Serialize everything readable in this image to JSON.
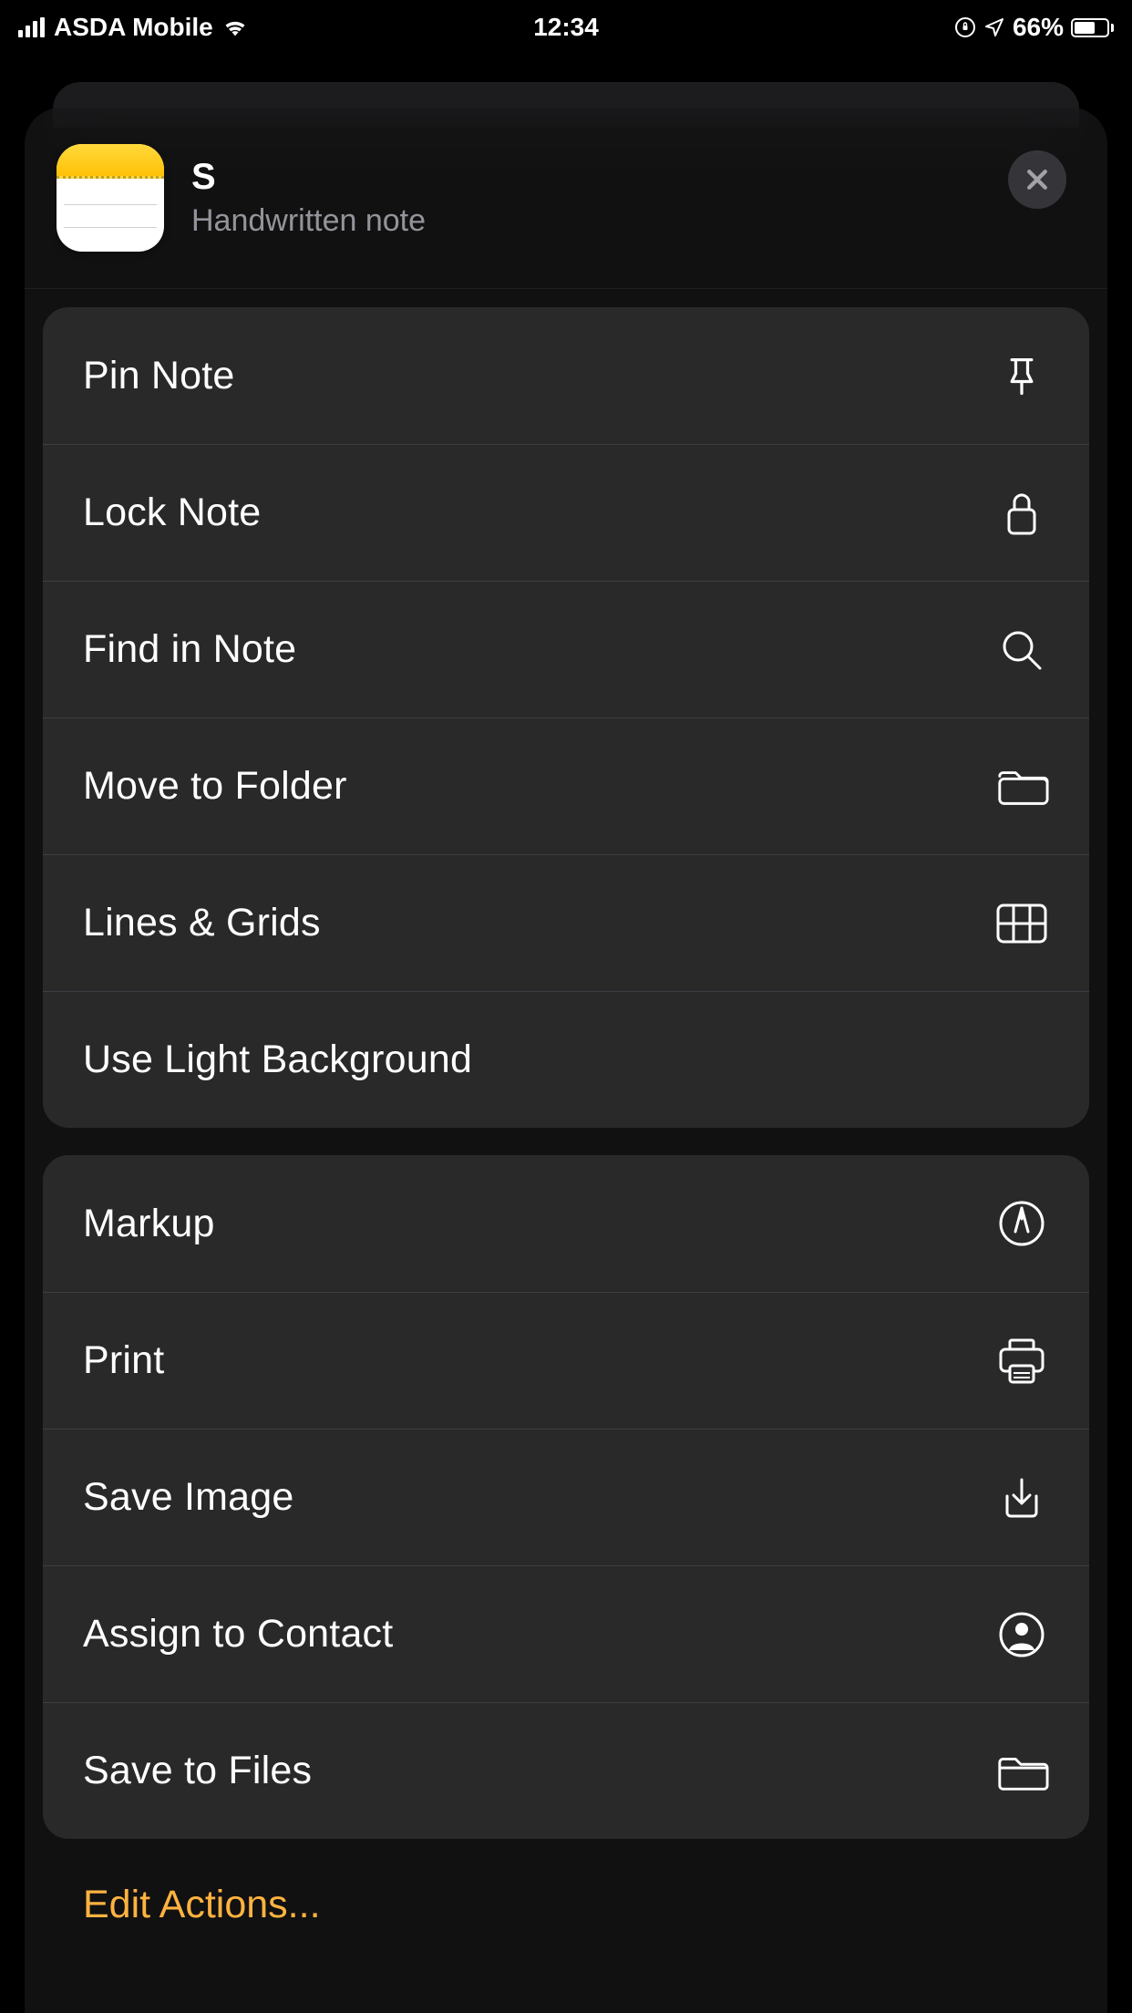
{
  "status": {
    "carrier": "ASDA Mobile",
    "time": "12:34",
    "battery_pct": "66%"
  },
  "header": {
    "title": "S",
    "subtitle": "Handwritten note"
  },
  "group1": {
    "pin": "Pin Note",
    "lock": "Lock Note",
    "find": "Find in Note",
    "move": "Move to Folder",
    "lines": "Lines & Grids",
    "light_bg": "Use Light Background"
  },
  "group2": {
    "markup": "Markup",
    "print": "Print",
    "save_image": "Save Image",
    "assign_contact": "Assign to Contact",
    "save_files": "Save to Files"
  },
  "footer": {
    "edit_actions": "Edit Actions..."
  },
  "colors": {
    "accent": "#ffb340"
  }
}
